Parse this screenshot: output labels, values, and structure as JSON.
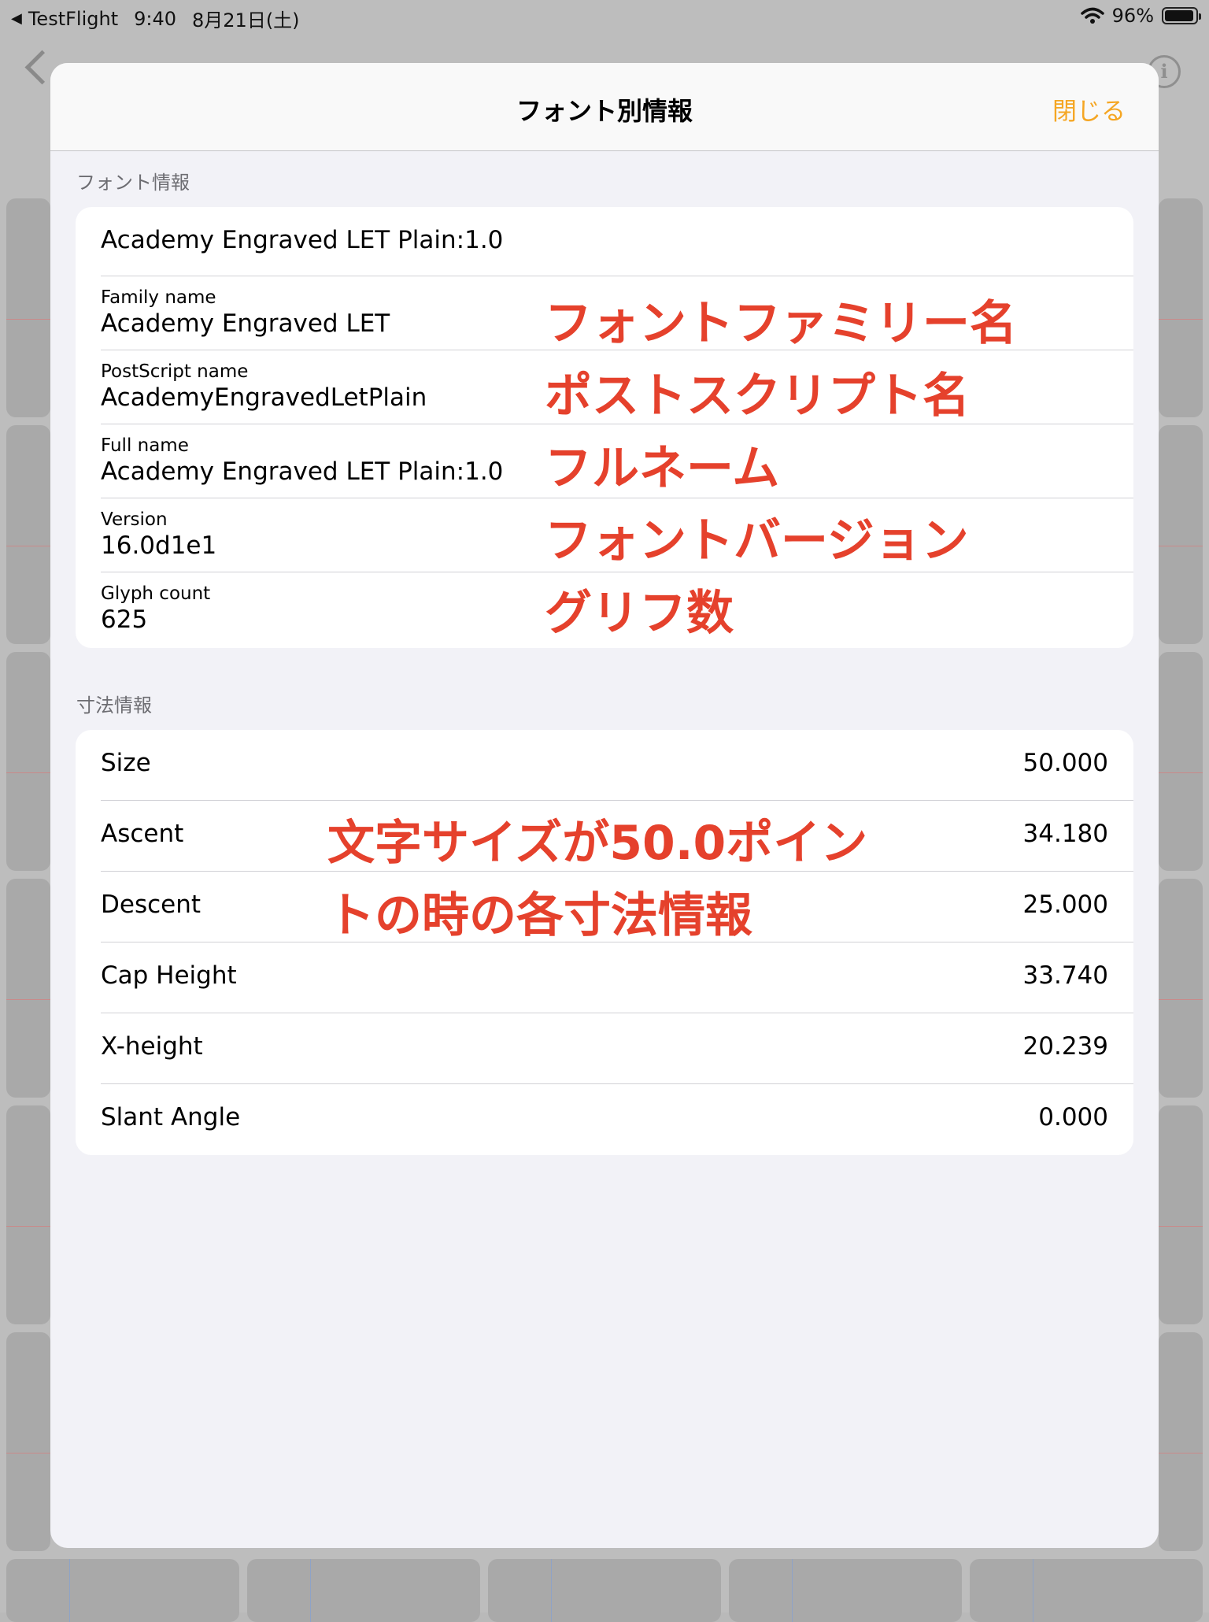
{
  "status_bar": {
    "back_app": "TestFlight",
    "time": "9:40",
    "date": "8月21日(土)",
    "battery": "96%"
  },
  "sheet": {
    "title": "フォント別情報",
    "close_label": "閉じる"
  },
  "font_info": {
    "header": "フォント情報",
    "summary": "Academy Engraved LET Plain:1.0",
    "rows": [
      {
        "label": "Family name",
        "value": "Academy Engraved LET",
        "annotation": "フォントファミリー名"
      },
      {
        "label": "PostScript name",
        "value": "AcademyEngravedLetPlain",
        "annotation": "ポストスクリプト名"
      },
      {
        "label": "Full name",
        "value": "Academy Engraved LET Plain:1.0",
        "annotation": "フルネーム"
      },
      {
        "label": "Version",
        "value": "16.0d1e1",
        "annotation": "フォントバージョン"
      },
      {
        "label": "Glyph count",
        "value": "625",
        "annotation": "グリフ数"
      }
    ]
  },
  "dimension_info": {
    "header": "寸法情報",
    "rows": [
      {
        "label": "Size",
        "value": "50.000"
      },
      {
        "label": "Ascent",
        "value": "34.180"
      },
      {
        "label": "Descent",
        "value": "25.000"
      },
      {
        "label": "Cap Height",
        "value": "33.740"
      },
      {
        "label": "X-height",
        "value": "20.239"
      },
      {
        "label": "Slant Angle",
        "value": "0.000"
      }
    ],
    "annotation_line1": "文字サイズが50.0ポイン",
    "annotation_line2": "トの時の各寸法情報"
  },
  "colors": {
    "accent": "#f5a623",
    "annotation": "#e5412c"
  }
}
